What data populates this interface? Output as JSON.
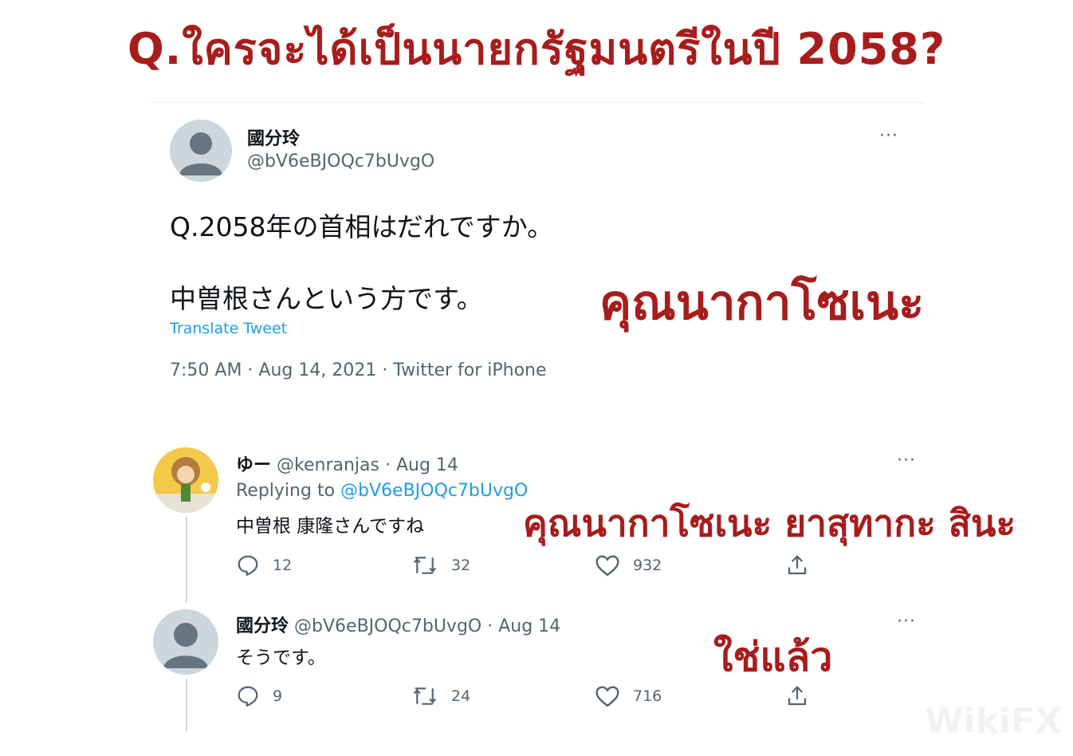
{
  "headline": "Q.ใครจะได้เป็นนายกรัฐมนตรีในปี 2058?",
  "main_tweet": {
    "name": "國分玲",
    "handle": "@bV6eBJOQc7bUvgO",
    "more": "···",
    "line1": "Q.2058年の首相はだれですか。",
    "line2": "中曽根さんという方です。",
    "translate": "Translate Tweet",
    "meta": "7:50 AM · Aug 14, 2021 · Twitter for iPhone",
    "overlay": "คุณนากาโซเนะ"
  },
  "reply1": {
    "name": "ゆー",
    "handle_date": "@kenranjas · Aug 14",
    "replying_label": "Replying to",
    "replying_to": "@bV6eBJOQc7bUvgO",
    "text": "中曽根 康隆さんですね",
    "overlay": "คุณนากาโซเนะ ยาสุทากะ สินะ",
    "more": "···",
    "replies": "12",
    "retweets": "32",
    "likes": "932"
  },
  "reply2": {
    "name": "國分玲",
    "handle_date": "@bV6eBJOQc7bUvgO · Aug 14",
    "text": "そうです。",
    "overlay": "ใช่แล้ว",
    "more": "···",
    "replies": "9",
    "retweets": "24",
    "likes": "716"
  },
  "watermark": "WikiFX",
  "colors": {
    "accent_red": "#a81c1c",
    "link_blue": "#1d9bf0",
    "muted": "#536471"
  },
  "icons": [
    "default-avatar-icon",
    "more-icon",
    "reply-icon",
    "retweet-icon",
    "like-icon",
    "share-icon"
  ]
}
